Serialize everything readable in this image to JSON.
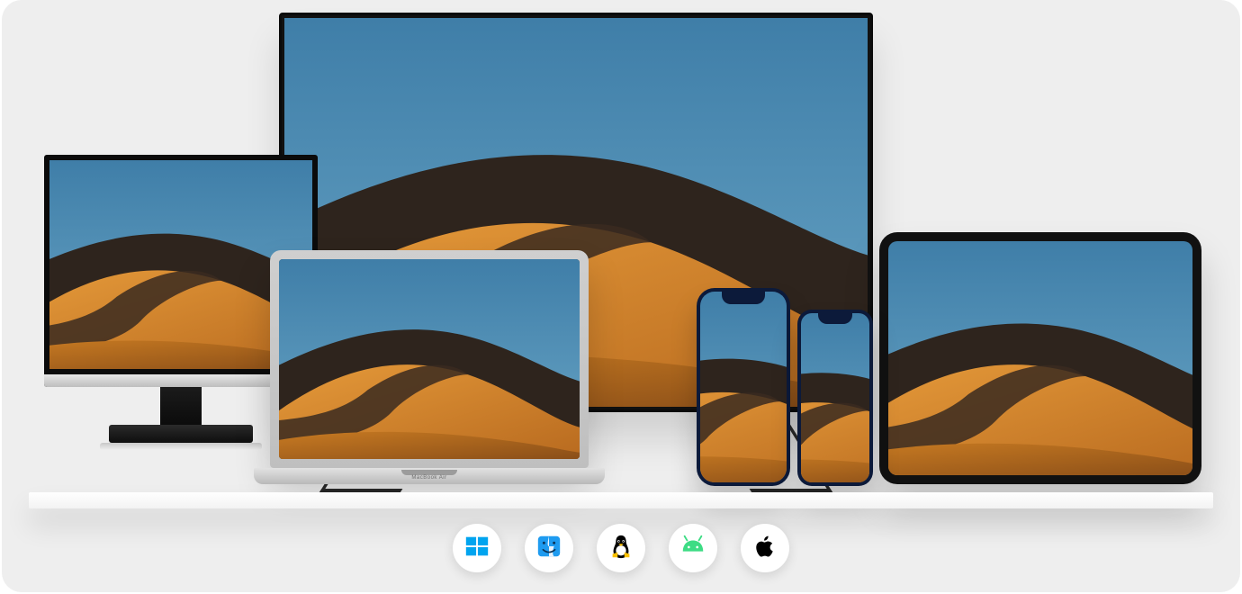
{
  "devices": {
    "tv": {
      "name": "tv"
    },
    "monitor": {
      "name": "desktop-monitor"
    },
    "laptop": {
      "name": "laptop",
      "brand_label": "MacBook Air"
    },
    "phone_large": {
      "name": "phone-large"
    },
    "phone_small": {
      "name": "phone-small"
    },
    "tablet": {
      "name": "tablet"
    }
  },
  "wallpaper": {
    "description": "desert-sand-dunes-under-blue-sky",
    "sky_top": "#3f7ea8",
    "sky_bottom": "#6aa6c6",
    "dune_light": "#d98a2b",
    "dune_mid": "#b86a1f",
    "dune_shadow": "#3a2a20"
  },
  "platforms": [
    {
      "id": "windows",
      "label": "Windows",
      "icon": "windows-icon",
      "color": "#00A4EF"
    },
    {
      "id": "macos",
      "label": "macOS",
      "icon": "finder-icon",
      "color": "#1E9BF0"
    },
    {
      "id": "linux",
      "label": "Linux",
      "icon": "tux-icon",
      "color": "#000000"
    },
    {
      "id": "android",
      "label": "Android",
      "icon": "android-icon",
      "color": "#3DDC84"
    },
    {
      "id": "ios",
      "label": "iOS",
      "icon": "apple-icon",
      "color": "#000000"
    }
  ]
}
